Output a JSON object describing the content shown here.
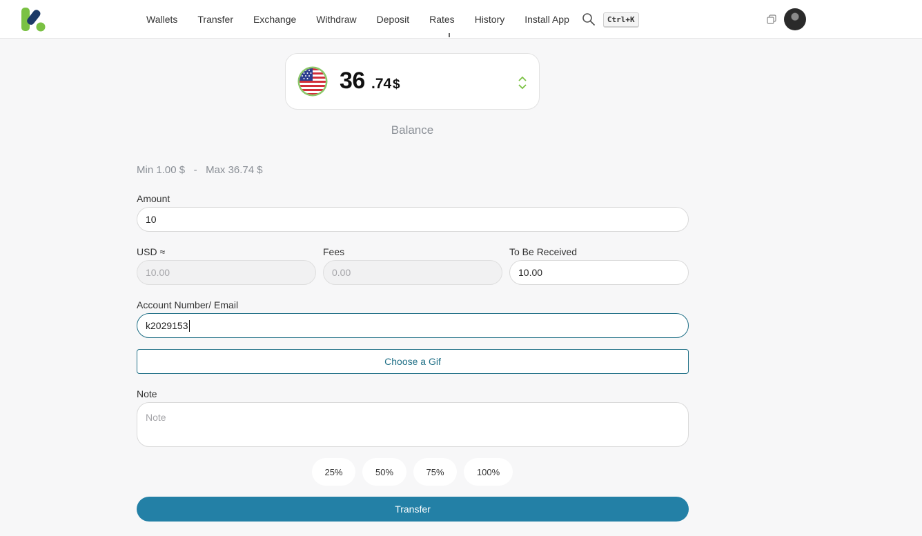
{
  "header": {
    "nav": [
      "Wallets",
      "Transfer",
      "Exchange",
      "Withdraw",
      "Deposit",
      "Rates",
      "History",
      "Install App"
    ],
    "shortcut": "Ctrl+K",
    "brand_colors": {
      "dark": "#1c3a68",
      "green": "#7ac143"
    }
  },
  "balance": {
    "int": "36",
    "dec": ".74",
    "currency": "$",
    "label": "Balance",
    "flag": "us-flag-icon"
  },
  "limits": {
    "min": "Min 1.00 $",
    "sep": "-",
    "max": "Max 36.74 $"
  },
  "form": {
    "amount_label": "Amount",
    "amount_value": "10",
    "usd_label": "USD ≈",
    "usd_value": "10.00",
    "fees_label": "Fees",
    "fees_value": "0.00",
    "receive_label": "To Be Received",
    "receive_value": "10.00",
    "account_label": "Account Number/ Email",
    "account_value": "k2029153",
    "gif_button": "Choose a Gif",
    "note_label": "Note",
    "note_placeholder": "Note",
    "percent_buttons": [
      "25%",
      "50%",
      "75%",
      "100%"
    ],
    "submit": "Transfer",
    "accent": "#2380a6"
  }
}
